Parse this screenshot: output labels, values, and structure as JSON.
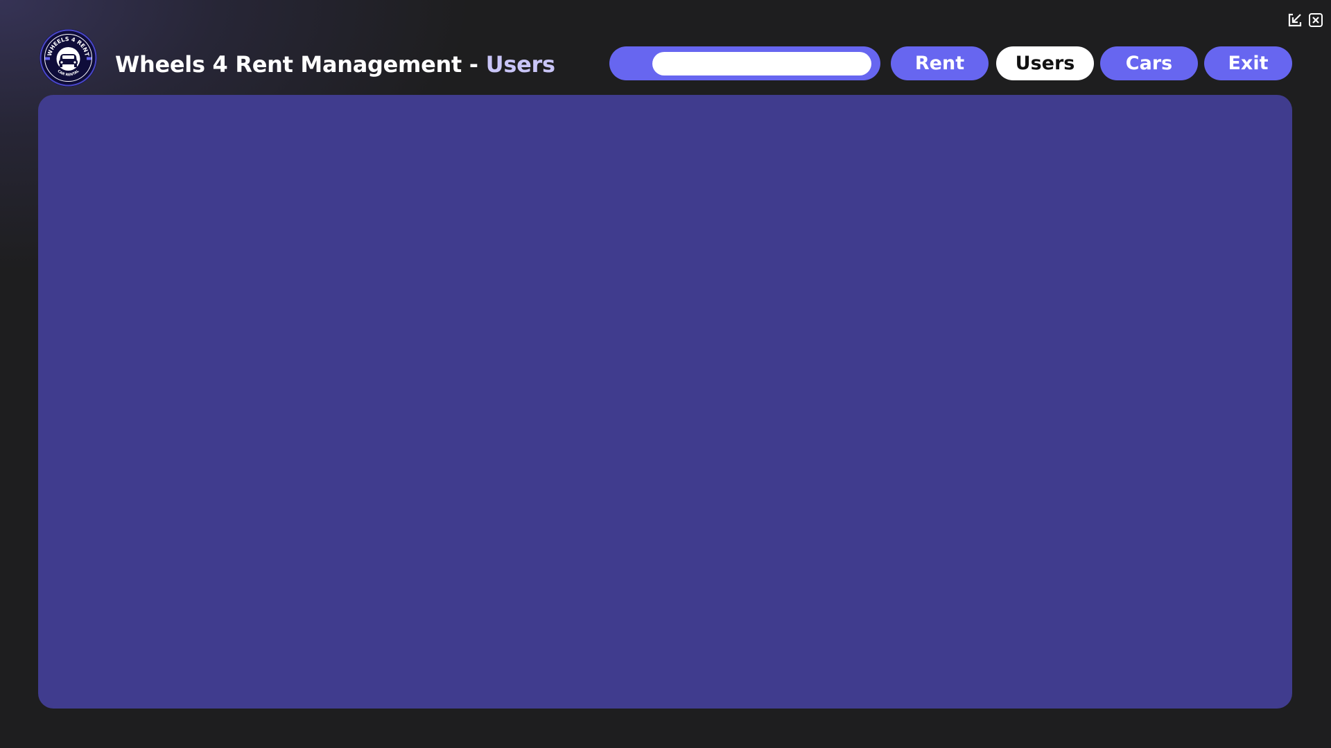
{
  "app": {
    "title": "Wheels 4 Rent Management",
    "separator": " - ",
    "section": "Users",
    "logo_text_top": "WHEELS 4 RENT",
    "logo_text_bottom": "CAR RENTAL"
  },
  "colors": {
    "background": "#1e1e1f",
    "accent": "#6766f0",
    "panel": "#403c8e",
    "section_title": "#c9c5f7",
    "active_button_bg": "#ffffff",
    "active_button_text": "#111111"
  },
  "search": {
    "value": "",
    "placeholder": ""
  },
  "nav": {
    "rent": "Rent",
    "users": "Users",
    "cars": "Cars",
    "exit": "Exit",
    "active": "Users"
  },
  "window_controls": {
    "minimize_icon": "minimize-arrow-icon",
    "close_icon": "close-icon"
  },
  "main": {
    "content": ""
  }
}
